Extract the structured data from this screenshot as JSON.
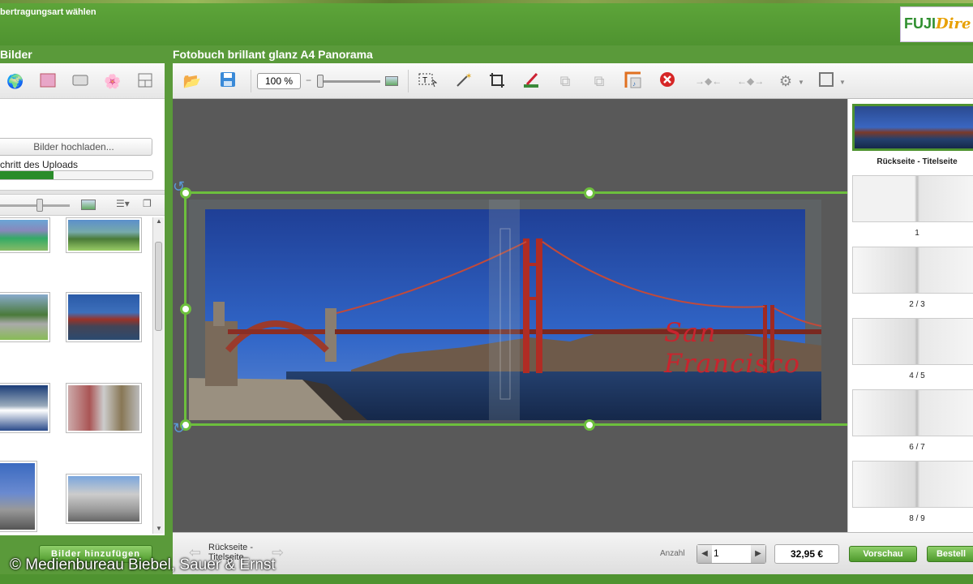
{
  "header": {
    "step_text": "bertragungsart wählen",
    "logo_primary": "FUJI",
    "logo_secondary": "Dire"
  },
  "left_panel": {
    "title": "Bilder",
    "upload_button": "Bilder hochladen...",
    "progress_label": "chritt des Uploads",
    "upload_progress_percent": 36,
    "add_button": "Bilder hinzufügen"
  },
  "editor": {
    "title": "Fotobuch brillant glanz A4 Panorama",
    "zoom_value": "100 %",
    "photo_caption": "San Francisco"
  },
  "pages": [
    {
      "label": "Rückseite - Titelseite",
      "active": true
    },
    {
      "label": "1",
      "active": false
    },
    {
      "label": "2 / 3",
      "active": false
    },
    {
      "label": "4 / 5",
      "active": false
    },
    {
      "label": "6 / 7",
      "active": false
    },
    {
      "label": "8 / 9",
      "active": false
    }
  ],
  "bottom": {
    "current_page_label": "Rückseite - Titelseite",
    "quantity_label": "Anzahl",
    "quantity_value": "1",
    "price": "32,95 €",
    "preview_button": "Vorschau",
    "order_button": "Bestell"
  },
  "watermark": "© Medienbureau Biebel, Sauer & Ernst",
  "colors": {
    "brand_green": "#4f9330",
    "selection_green": "#6dbf3d",
    "caption_red": "#c8242e"
  }
}
